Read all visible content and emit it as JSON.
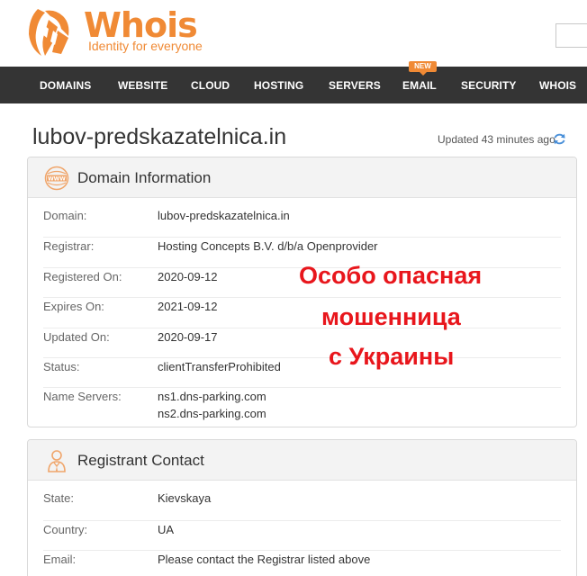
{
  "brand": {
    "name": "Whois",
    "tagline": "Identity for everyone",
    "color": "#f08a35"
  },
  "nav": {
    "items": [
      "DOMAINS",
      "WEBSITE",
      "CLOUD",
      "HOSTING",
      "SERVERS",
      "EMAIL",
      "SECURITY",
      "WHOIS"
    ],
    "new_badge": "NEW"
  },
  "page": {
    "domain": "lubov-predskazatelnica.in",
    "updated": "Updated 43 minutes ago"
  },
  "domain_info": {
    "title": "Domain Information",
    "icon": "www-icon",
    "rows": [
      {
        "label": "Domain:",
        "value": "lubov-predskazatelnica.in"
      },
      {
        "label": "Registrar:",
        "value": "Hosting Concepts B.V. d/b/a Openprovider"
      },
      {
        "label": "Registered On:",
        "value": "2020-09-12"
      },
      {
        "label": "Expires On:",
        "value": "2021-09-12"
      },
      {
        "label": "Updated On:",
        "value": "2020-09-17"
      },
      {
        "label": "Status:",
        "value": "clientTransferProhibited"
      },
      {
        "label": "Name Servers:",
        "value": "ns1.dns-parking.com",
        "value2": "ns2.dns-parking.com"
      }
    ]
  },
  "registrant": {
    "title": "Registrant Contact",
    "icon": "person-icon",
    "rows": [
      {
        "label": "State:",
        "value": "Kievskaya"
      },
      {
        "label": "Country:",
        "value": "UA"
      },
      {
        "label": "Email:",
        "value": "Please contact the Registrar listed above"
      }
    ]
  },
  "overlay": {
    "line1": "Особо опасная",
    "line2": "мошенница",
    "line3": "с Украины",
    "color": "#e8161c"
  }
}
